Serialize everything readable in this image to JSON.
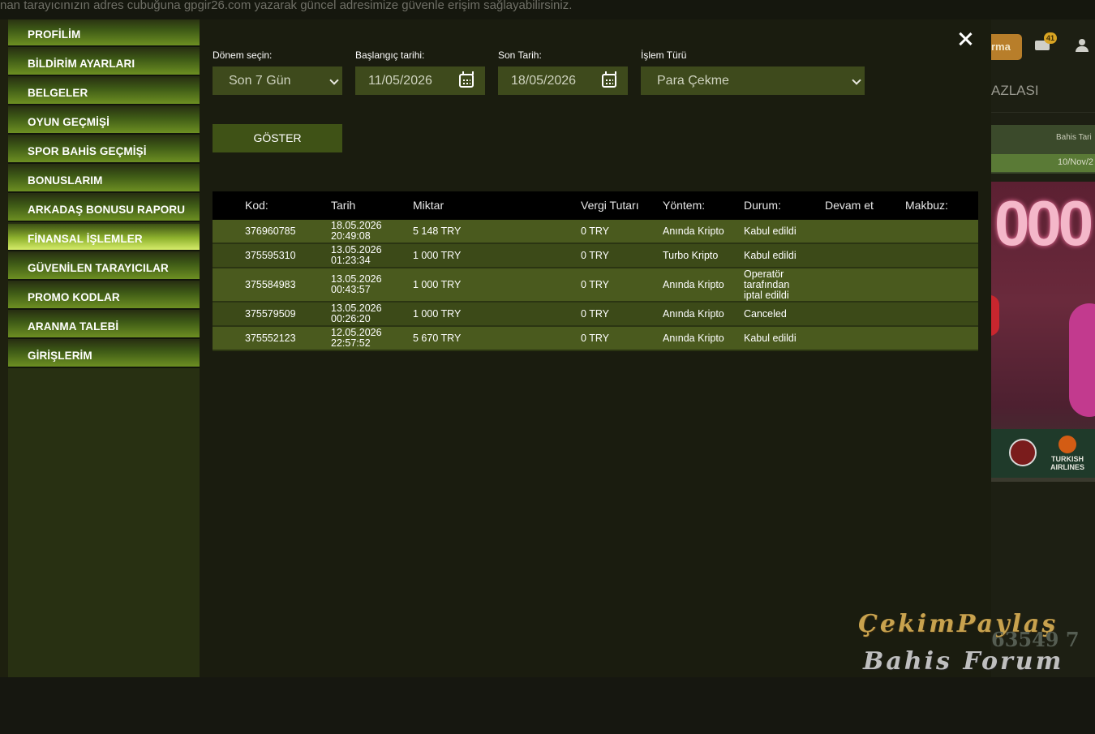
{
  "banner": "nan tarayıcınızın adres cubuğuna gpgir26.com yazarak güncel adresimize güvenle erişim sağlayabilirsiniz.",
  "background": {
    "header_button_partial": "rma",
    "mail_badge": "41",
    "section_title_partial": "AZLASI",
    "table_header_partial": "Bahis Tari",
    "table_cell_partial": "10/Nov/2",
    "promo_text": "000",
    "logo_text": "TURKISH AIRLINES"
  },
  "sidebar": {
    "items": [
      {
        "label": "PROFİLİM"
      },
      {
        "label": "BİLDİRİM AYARLARI"
      },
      {
        "label": "BELGELER"
      },
      {
        "label": "OYUN GEÇMİŞİ"
      },
      {
        "label": "SPOR BAHİS GEÇMİŞİ"
      },
      {
        "label": "BONUSLARIM"
      },
      {
        "label": "ARKADAŞ BONUSU RAPORU"
      },
      {
        "label": "FİNANSAL İŞLEMLER",
        "active": true
      },
      {
        "label": "GÜVENİLEN TARAYICILAR"
      },
      {
        "label": "PROMO KODLAR"
      },
      {
        "label": "ARANMA TALEBİ"
      },
      {
        "label": "GİRİŞLERİM"
      }
    ]
  },
  "filters": {
    "period_label": "Dönem seçin:",
    "period_value": "Son 7 Gün",
    "start_label": "Başlangıç tarihi:",
    "start_value": "11/05/2026",
    "end_label": "Son Tarih:",
    "end_value": "18/05/2026",
    "type_label": "İşlem Türü",
    "type_value": "Para Çekme",
    "show_button": "GÖSTER"
  },
  "table": {
    "headers": [
      "Kod:",
      "Tarih",
      "Miktar",
      "Vergi Tutarı",
      "Yöntem:",
      "Durum:",
      "Devam et",
      "Makbuz:"
    ],
    "rows": [
      {
        "kod": "376960785",
        "date": "18.05.2026",
        "time": "20:49:08",
        "amount": "5 148 TRY",
        "tax": "0 TRY",
        "method": "Anında Kripto",
        "status": "Kabul edildi"
      },
      {
        "kod": "375595310",
        "date": "13.05.2026",
        "time": "01:23:34",
        "amount": "1 000 TRY",
        "tax": "0 TRY",
        "method": "Turbo Kripto",
        "status": "Kabul edildi"
      },
      {
        "kod": "375584983",
        "date": "13.05.2026",
        "time": "00:43:57",
        "amount": "1 000 TRY",
        "tax": "0 TRY",
        "method": "Anında Kripto",
        "status": "Operatör\ntarafından\niptal edildi"
      },
      {
        "kod": "375579509",
        "date": "13.05.2026",
        "time": "00:26:20",
        "amount": "1 000 TRY",
        "tax": "0 TRY",
        "method": "Anında Kripto",
        "status": "Canceled"
      },
      {
        "kod": "375552123",
        "date": "12.05.2026",
        "time": "22:57:52",
        "amount": "5 670 TRY",
        "tax": "0 TRY",
        "method": "Anında Kripto",
        "status": "Kabul edildi"
      }
    ]
  },
  "watermark": {
    "line1": "ÇekimPaylaş",
    "line2": "Bahis Forum",
    "number": "63549 7"
  },
  "colors": {
    "sidebar_active": "#d6ec6a",
    "row_primary": "#4a5a1e",
    "row_alt": "#3c4a18",
    "field_bg": "#3e4a1c"
  }
}
